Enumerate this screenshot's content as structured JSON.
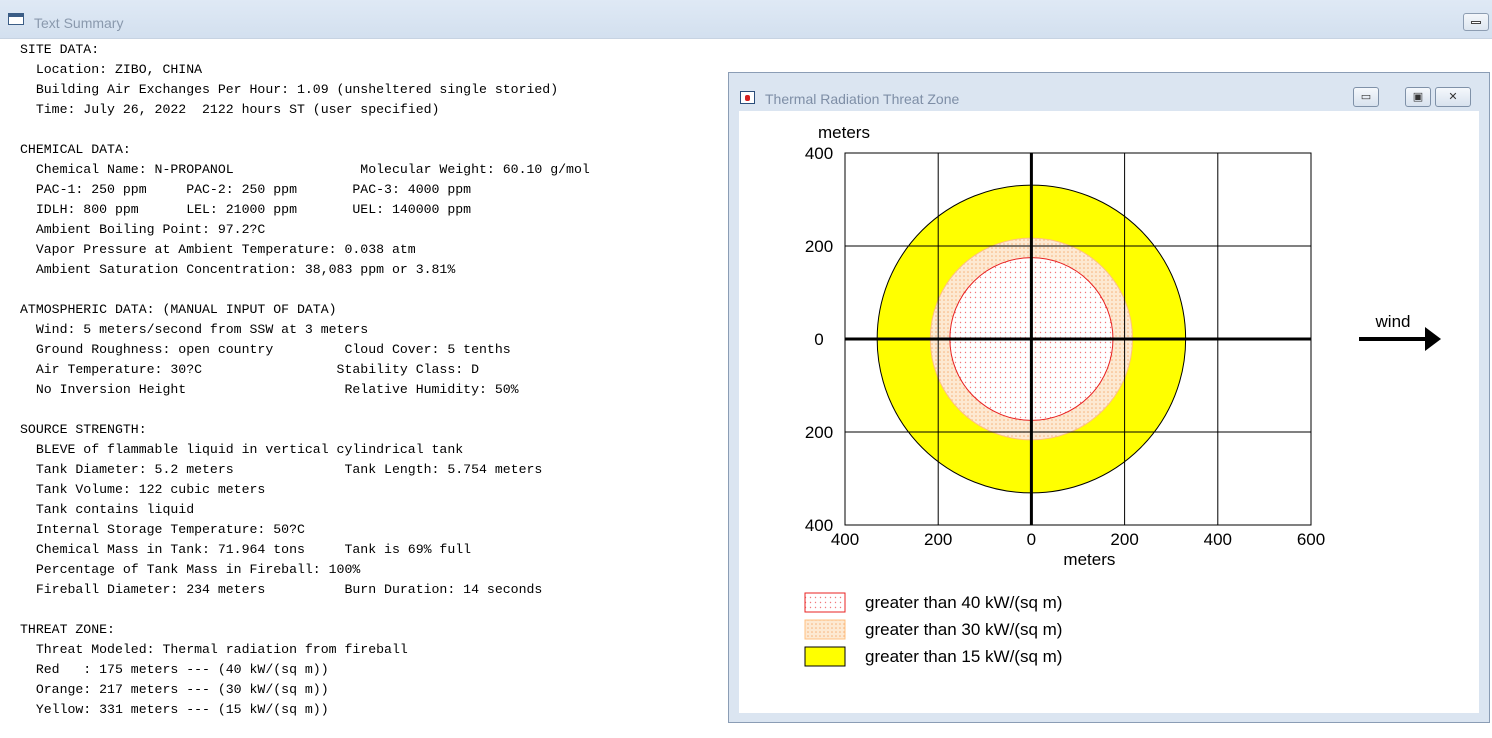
{
  "window": {
    "title": "Text Summary",
    "minimize_icon": "minimize-icon"
  },
  "summary_lines": [
    "SITE DATA:",
    "  Location: ZIBO, CHINA",
    "  Building Air Exchanges Per Hour: 1.09 (unsheltered single storied)",
    "  Time: July 26, 2022  2122 hours ST (user specified)",
    "",
    "CHEMICAL DATA:",
    "  Chemical Name: N-PROPANOL                Molecular Weight: 60.10 g/mol",
    "  PAC-1: 250 ppm     PAC-2: 250 ppm       PAC-3: 4000 ppm",
    "  IDLH: 800 ppm      LEL: 21000 ppm       UEL: 140000 ppm",
    "  Ambient Boiling Point: 97.2?C",
    "  Vapor Pressure at Ambient Temperature: 0.038 atm",
    "  Ambient Saturation Concentration: 38,083 ppm or 3.81%",
    "",
    "ATMOSPHERIC DATA: (MANUAL INPUT OF DATA)",
    "  Wind: 5 meters/second from SSW at 3 meters",
    "  Ground Roughness: open country         Cloud Cover: 5 tenths",
    "  Air Temperature: 30?C                 Stability Class: D",
    "  No Inversion Height                    Relative Humidity: 50%",
    "",
    "SOURCE STRENGTH:",
    "  BLEVE of flammable liquid in vertical cylindrical tank",
    "  Tank Diameter: 5.2 meters              Tank Length: 5.754 meters",
    "  Tank Volume: 122 cubic meters",
    "  Tank contains liquid",
    "  Internal Storage Temperature: 50?C",
    "  Chemical Mass in Tank: 71.964 tons     Tank is 69% full",
    "  Percentage of Tank Mass in Fireball: 100%",
    "  Fireball Diameter: 234 meters          Burn Duration: 14 seconds",
    "",
    "THREAT ZONE:",
    "  Threat Modeled: Thermal radiation from fireball",
    "  Red   : 175 meters --- (40 kW/(sq m))",
    "  Orange: 217 meters --- (30 kW/(sq m))",
    "  Yellow: 331 meters --- (15 kW/(sq m))"
  ],
  "threat_window": {
    "title": "Thermal Radiation Threat Zone",
    "buttons": {
      "minimize": "▭",
      "maximize": "▣",
      "close": "✕"
    }
  },
  "chart_data": {
    "type": "threat-zone-plot",
    "y_unit_label": "meters",
    "xlabel": "meters",
    "x_tick_labels": [
      "400",
      "200",
      "0",
      "200",
      "400",
      "600"
    ],
    "y_tick_labels": [
      "400",
      "200",
      "0",
      "200",
      "400"
    ],
    "xlim": [
      -400,
      600
    ],
    "ylim": [
      -400,
      400
    ],
    "grid": true,
    "zones": [
      {
        "name": "Yellow",
        "radius": 331,
        "level": "15 kW/(sq m)",
        "fill": "#ffff00",
        "stroke": "#000000"
      },
      {
        "name": "Orange",
        "radius": 217,
        "level": "30 kW/(sq m)",
        "fill": "#fde3c6",
        "stroke": "#ffc080"
      },
      {
        "name": "Red",
        "radius": 175,
        "level": "40 kW/(sq m)",
        "fill": "#fde9ea",
        "stroke": "#e82020"
      }
    ],
    "legend": [
      {
        "label": "greater than 40 kW/(sq m)",
        "fill": "#fde9ea",
        "stroke": "#e82020"
      },
      {
        "label": "greater than 30 kW/(sq m)",
        "fill": "#fde3c6",
        "stroke": "#ffc080"
      },
      {
        "label": "greater than 15 kW/(sq m)",
        "fill": "#ffff00",
        "stroke": "#000000"
      }
    ],
    "wind_label": "wind"
  }
}
